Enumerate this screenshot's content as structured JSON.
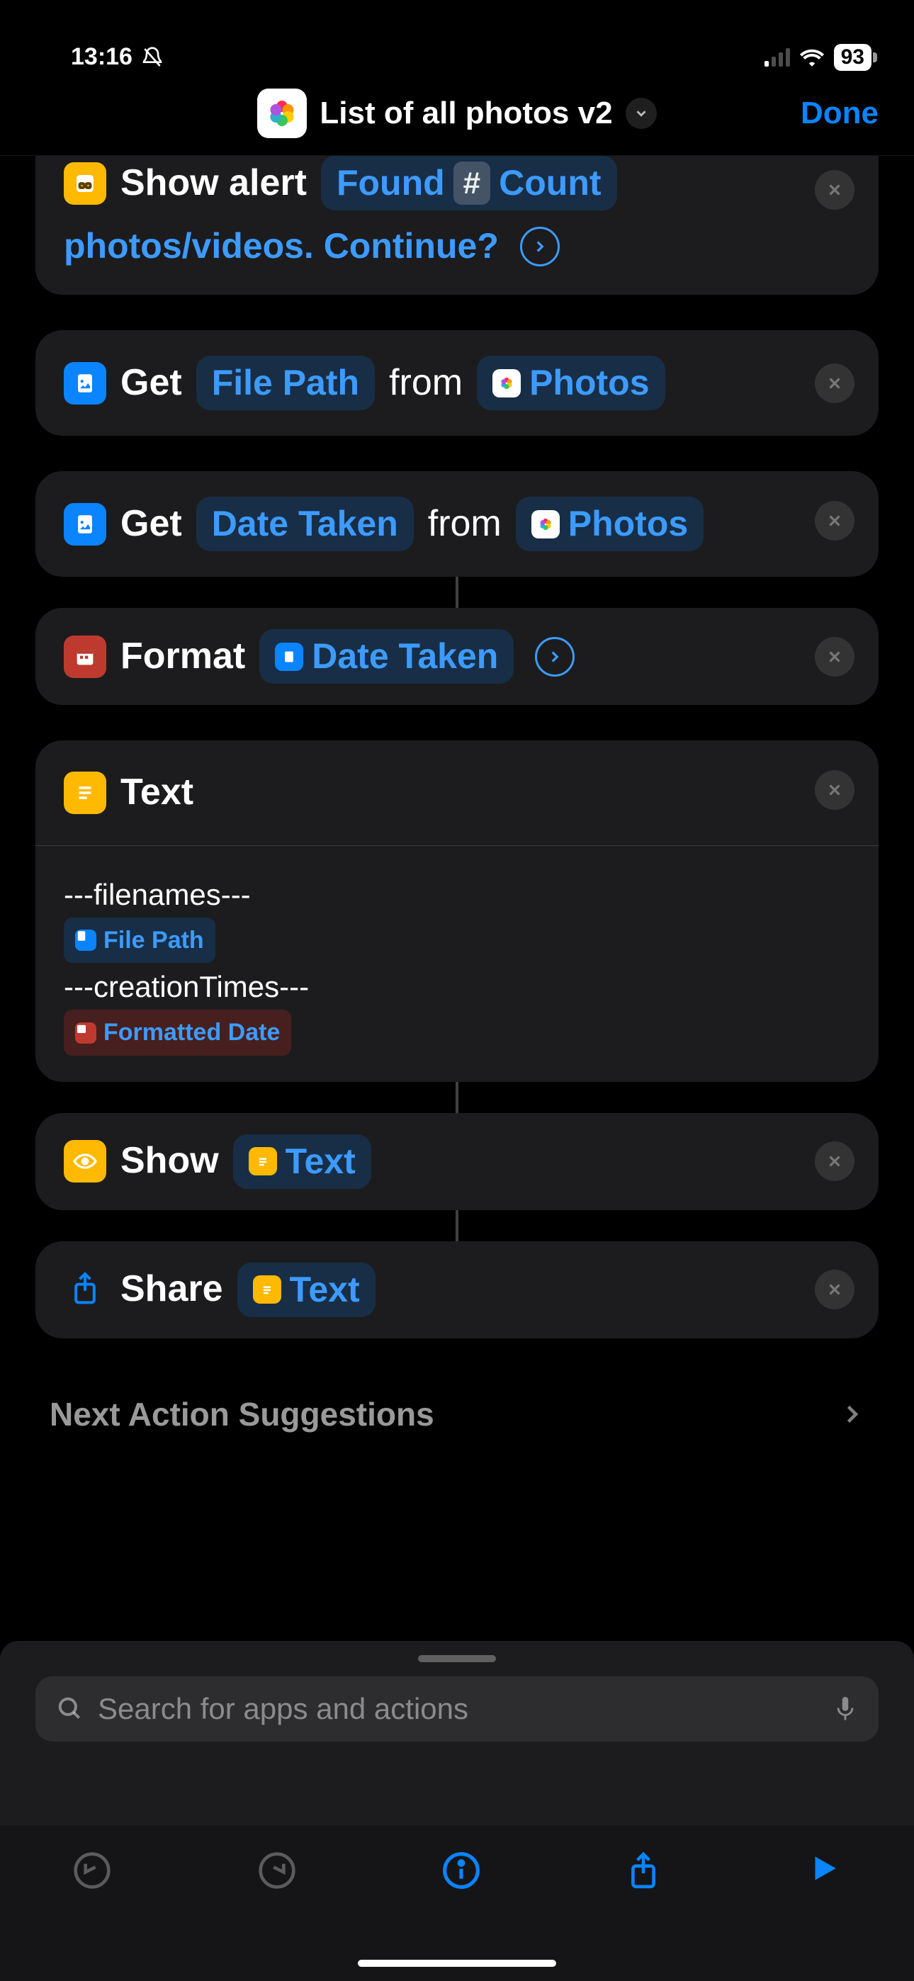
{
  "status": {
    "time": "13:16",
    "battery": "93"
  },
  "header": {
    "title": "List of all photos v2",
    "done": "Done"
  },
  "actions": {
    "alert": {
      "name": "Show alert",
      "token_prefix": "Found",
      "count_badge": "#",
      "count_var": "Count",
      "trailing": "photos/videos. Continue?"
    },
    "get_file_path": {
      "label": "Get",
      "detail": "File Path",
      "from": "from",
      "source": "Photos"
    },
    "get_date_taken": {
      "label": "Get",
      "detail": "Date Taken",
      "from": "from",
      "source": "Photos"
    },
    "format_date": {
      "label": "Format",
      "var": "Date Taken"
    },
    "text": {
      "label": "Text",
      "line1": "---filenames---",
      "chip1": "File Path",
      "line2": "---creationTimes---",
      "chip2": "Formatted Date"
    },
    "show": {
      "label": "Show",
      "var": "Text"
    },
    "share": {
      "label": "Share",
      "var": "Text"
    }
  },
  "suggestions": {
    "label": "Next Action Suggestions"
  },
  "sheet": {
    "search_placeholder": "Search for apps and actions"
  }
}
